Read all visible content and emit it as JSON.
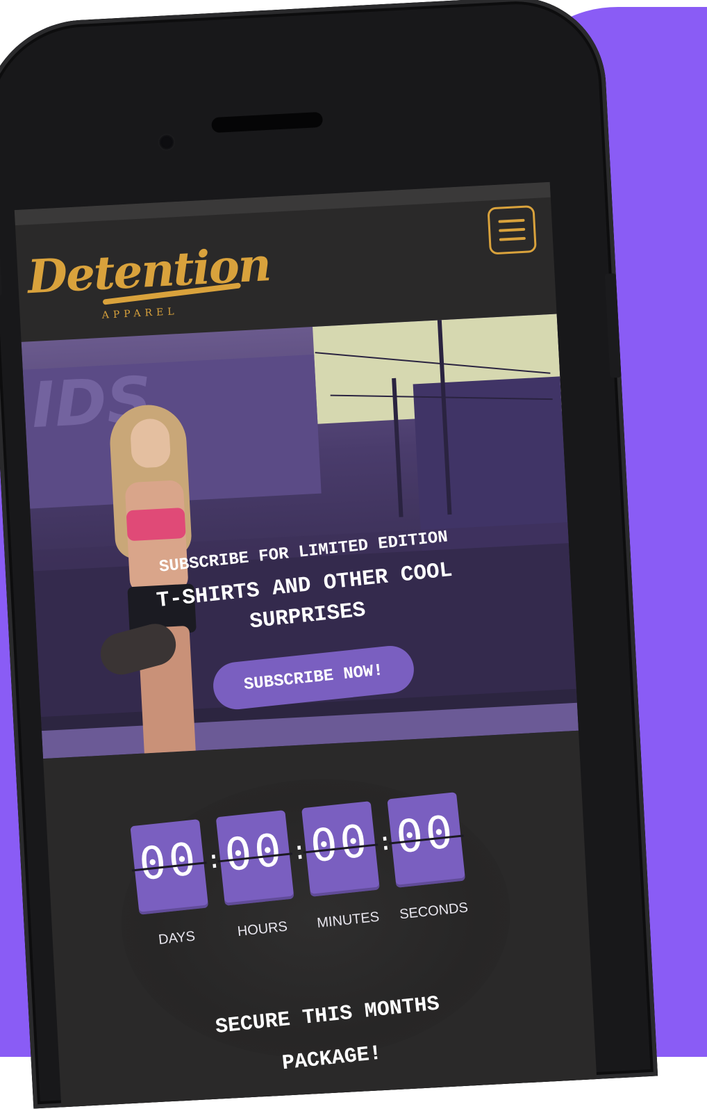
{
  "brand": {
    "name": "Detention",
    "subtitle": "APPAREL",
    "accent_color": "#d9a23c",
    "primary_color": "#7a5fc0",
    "background_color": "#8a5cf5"
  },
  "header": {
    "menu_icon": "hamburger-menu-icon"
  },
  "hero": {
    "line1": "SUBSCRIBE FOR LIMITED EDITION",
    "line2": "T-SHIRTS AND OTHER COOL SURPRISES",
    "cta_label": "SUBSCRIBE NOW!"
  },
  "countdown": {
    "units": [
      {
        "value": "00",
        "label": "DAYS"
      },
      {
        "value": "00",
        "label": "HOURS"
      },
      {
        "value": "00",
        "label": "MINUTES"
      },
      {
        "value": "00",
        "label": "SECONDS"
      }
    ],
    "separator": ":"
  },
  "promo": {
    "text": "SECURE THIS MONTHS PACKAGE!"
  }
}
